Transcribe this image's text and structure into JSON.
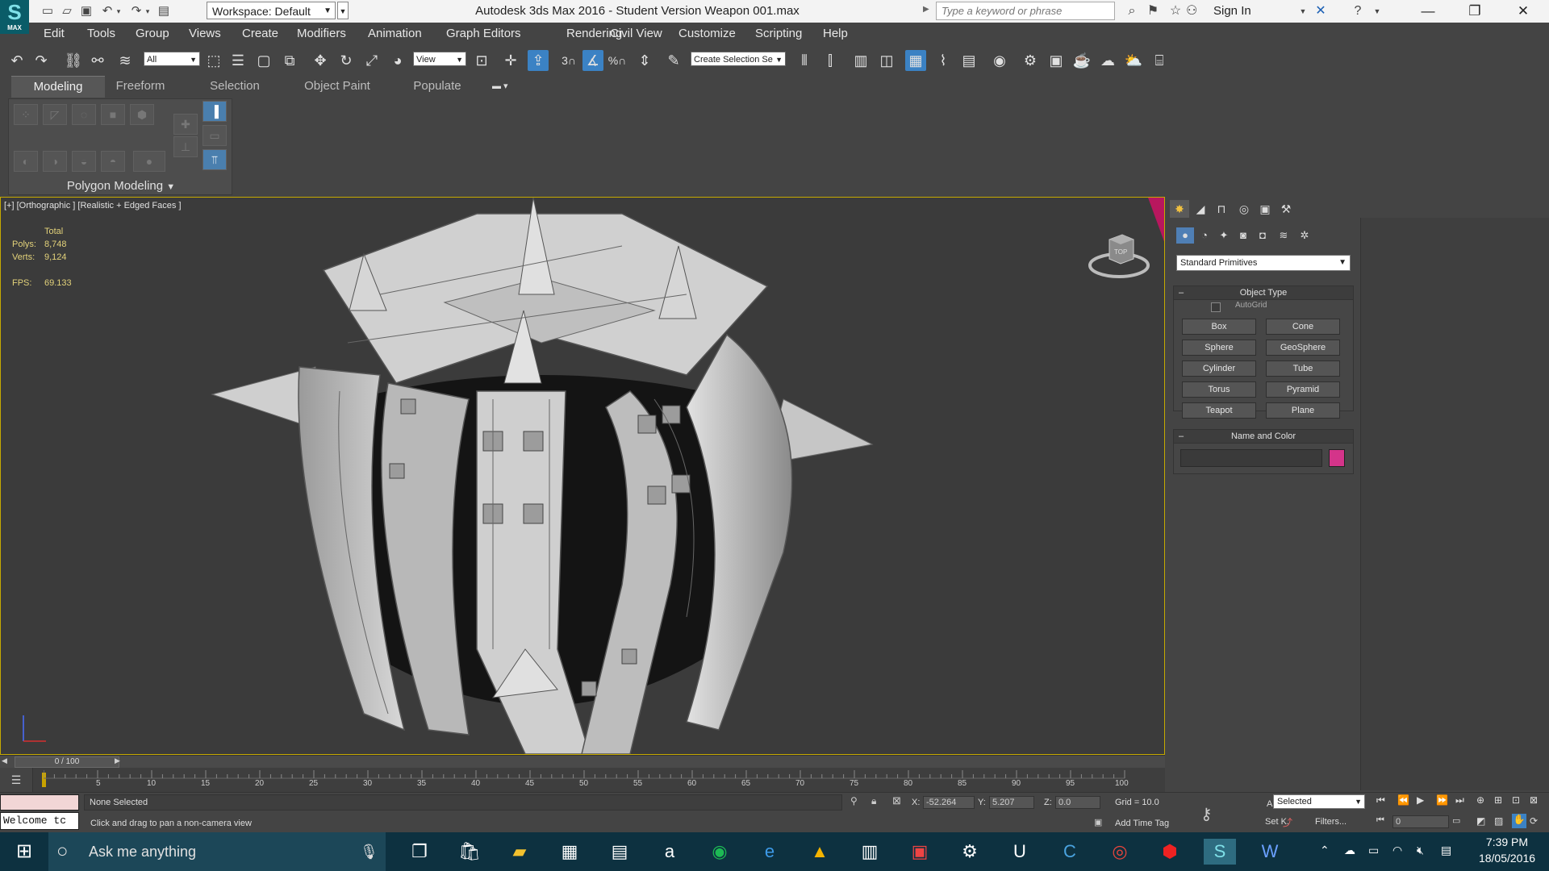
{
  "app": {
    "logo_text": "MAX",
    "window_title": "Autodesk 3ds Max 2016 - Student Version    Weapon 001.max",
    "workspace": "Workspace: Default",
    "search_placeholder": "Type a keyword or phrase",
    "sign_in": "Sign In"
  },
  "menu": [
    "Edit",
    "Tools",
    "Group",
    "Views",
    "Create",
    "Modifiers",
    "Animation",
    "Graph Editors",
    "Rendering",
    "Civil View",
    "Customize",
    "Scripting",
    "Help"
  ],
  "toolbar": {
    "selection_filter": "All",
    "reference_coord": "View",
    "snap_label": "3",
    "named_selection": "Create Selection Se"
  },
  "ribbon": {
    "tabs": [
      "Modeling",
      "Freeform",
      "Selection",
      "Object Paint",
      "Populate"
    ],
    "active_tab": "Modeling",
    "panel_label": "Polygon Modeling"
  },
  "viewport": {
    "label": "[+] [Orthographic ] [Realistic + Edged Faces ]",
    "stats": {
      "total_label": "Total",
      "polys_label": "Polys:",
      "polys_value": "8,748",
      "verts_label": "Verts:",
      "verts_value": "9,124",
      "fps_label": "FPS:",
      "fps_value": "69.133"
    },
    "viewcube_label": "TOP"
  },
  "command_panel": {
    "category": "Standard Primitives",
    "object_type_title": "Object Type",
    "autogrid_label": "AutoGrid",
    "primitives": [
      "Box",
      "Cone",
      "Sphere",
      "GeoSphere",
      "Cylinder",
      "Tube",
      "Torus",
      "Pyramid",
      "Teapot",
      "Plane"
    ],
    "name_color_title": "Name and Color",
    "name_value": "",
    "color": "#d4348a"
  },
  "timeline": {
    "frame_display": "0 / 100",
    "ticks": [
      "5",
      "10",
      "15",
      "20",
      "25",
      "30",
      "35",
      "40",
      "45",
      "50",
      "55",
      "60",
      "65",
      "70",
      "75",
      "80",
      "85",
      "90",
      "95",
      "100"
    ]
  },
  "status": {
    "maxscript_text": "Welcome tc",
    "selection_status": "None Selected",
    "prompt": "Click and drag to pan a non-camera view",
    "x_label": "X:",
    "x_value": "-52.264",
    "y_label": "Y:",
    "y_value": "5.207",
    "z_label": "Z:",
    "z_value": "0.0",
    "grid": "Grid = 10.0",
    "add_time_tag": "Add Time Tag",
    "auto_key": "Auto",
    "set_key": "Set K.",
    "key_filter": "Selected",
    "filters": "Filters...",
    "current_frame": "0"
  },
  "taskbar": {
    "cortana_text": "Ask me anything",
    "time": "7:39 PM",
    "date": "18/05/2016"
  }
}
